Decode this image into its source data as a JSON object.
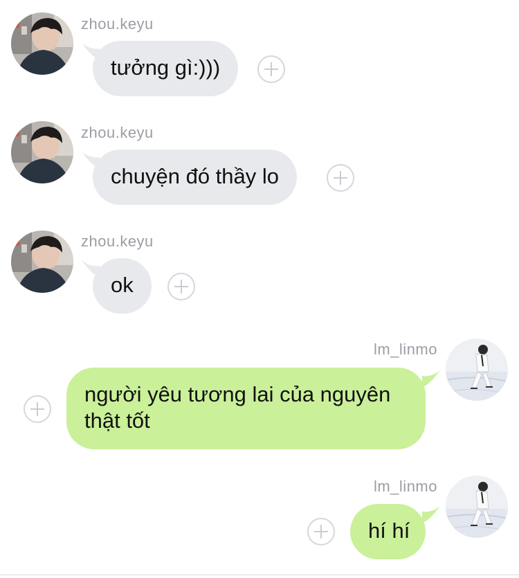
{
  "messages": [
    {
      "sender": "zhou.keyu",
      "text": "tưởng gì:)))",
      "direction": "incoming",
      "avatar_icon": "user-avatar-boy-icon"
    },
    {
      "sender": "zhou.keyu",
      "text": "chuyện đó thầy lo",
      "direction": "incoming",
      "avatar_icon": "user-avatar-boy-icon"
    },
    {
      "sender": "zhou.keyu",
      "text": "ok",
      "direction": "incoming",
      "avatar_icon": "user-avatar-boy-icon"
    },
    {
      "sender": "lm_linmo",
      "text": "người yêu tương lai của nguyên thật tốt",
      "direction": "outgoing",
      "avatar_icon": "user-avatar-skater-icon"
    },
    {
      "sender": "lm_linmo",
      "text": "hí hí",
      "direction": "outgoing",
      "avatar_icon": "user-avatar-skater-icon"
    }
  ],
  "colors": {
    "incoming_bubble": "#e7e9ec",
    "outgoing_bubble": "#caf099",
    "sender_name": "#9a9ea3",
    "reaction_icon": "#c9ccd1"
  },
  "icons": {
    "reaction": "add-reaction-plus-icon"
  }
}
